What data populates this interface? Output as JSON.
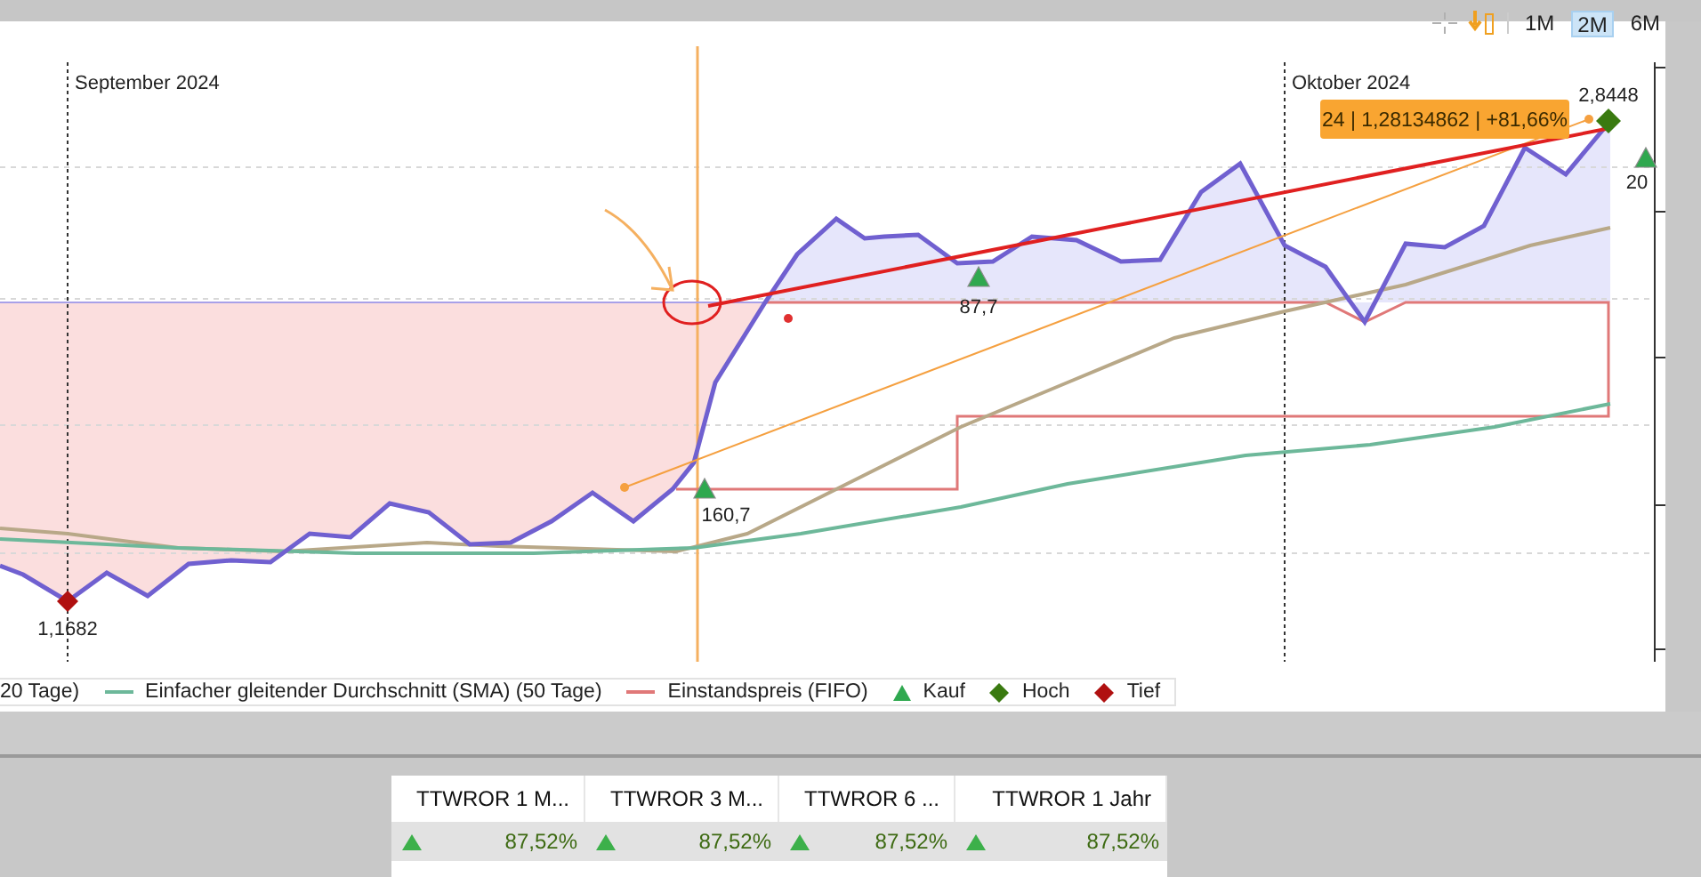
{
  "toolbar": {
    "buttons": [
      {
        "label": "1M",
        "selected": false
      },
      {
        "label": "2M",
        "selected": true
      },
      {
        "label": "6M",
        "selected": false
      }
    ]
  },
  "chart": {
    "month_labels": [
      "September 2024",
      "Oktober 2024"
    ],
    "point_labels": [
      {
        "kind": "low",
        "text": "1,1682"
      },
      {
        "kind": "buy",
        "text": "160,7"
      },
      {
        "kind": "buy",
        "text": "87,7"
      },
      {
        "kind": "high",
        "text": "2,8448"
      },
      {
        "kind": "buy",
        "text": "20"
      }
    ],
    "tooltip": "24 | 1,28134862 | +81,66%"
  },
  "legend": [
    {
      "kind": "label",
      "label": "20 Tage)"
    },
    {
      "kind": "line",
      "color": "#6db89a",
      "label": "Einfacher gleitender Durchschnitt (SMA) (50 Tage)"
    },
    {
      "kind": "line",
      "color": "#e07878",
      "label": "Einstandspreis (FIFO)"
    },
    {
      "kind": "triangle",
      "color": "#2fa84f",
      "label": "Kauf"
    },
    {
      "kind": "diamond",
      "color": "#3a7a10",
      "label": "Hoch"
    },
    {
      "kind": "diamond",
      "color": "#b01010",
      "label": "Tief"
    }
  ],
  "table": {
    "columns": [
      "TTWROR 1 M...",
      "TTWROR 3 M...",
      "TTWROR 6 ...",
      "TTWROR 1 Jahr"
    ],
    "rows": [
      [
        {
          "kind": "up",
          "value": "87,52%"
        },
        {
          "kind": "up",
          "value": "87,52%"
        },
        {
          "kind": "up",
          "value": "87,52%"
        },
        {
          "kind": "up",
          "value": "87,52%"
        }
      ]
    ]
  }
}
